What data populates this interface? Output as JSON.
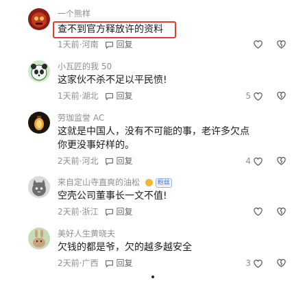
{
  "comments": [
    {
      "user": "一个熊样",
      "text": "查不到官方释放许的资料",
      "time": "1天前",
      "location": "河南",
      "reply_label": "回复",
      "likes": "",
      "avatar": "red-mask-avatar",
      "highlighted": true
    },
    {
      "user": "小瓦匠的我 50",
      "text": "这家伙不杀不足以平民愤!",
      "time": "1天前",
      "location": "湖北",
      "reply_label": "回复",
      "likes": "5",
      "avatar": "panda-avatar"
    },
    {
      "user": "劳珈监誉 AC",
      "text_line1": "这就是中国人，没有不可能的事，老许多欠点",
      "text_line2": "你更没事好样的。",
      "time": "2天前",
      "location": "河北",
      "reply_label": "回复",
      "likes": "4",
      "avatar": "lantern-avatar"
    },
    {
      "user": "来自定山寺直爽的油松",
      "fan_badge": "粉丝",
      "text": "空壳公司董事长一文不值!",
      "time": "2天前",
      "location": "浙江",
      "reply_label": "回复",
      "likes": "",
      "avatar": "cat-avatar"
    },
    {
      "user": "美好人生黄晓夫",
      "text": "欠钱的都是爷，欠的越多越安全",
      "time": "2天前",
      "location": "广西",
      "reply_label": "回复",
      "likes": "3",
      "avatar": "rabbit-avatar"
    }
  ],
  "separator": "·",
  "colors": {
    "highlight_border": "#e03a2f",
    "meta_text": "#8e8e8e"
  },
  "icons": [
    "reply-bubble-icon",
    "heart-icon",
    "broken-heart-icon",
    "verified-badge-icon"
  ]
}
